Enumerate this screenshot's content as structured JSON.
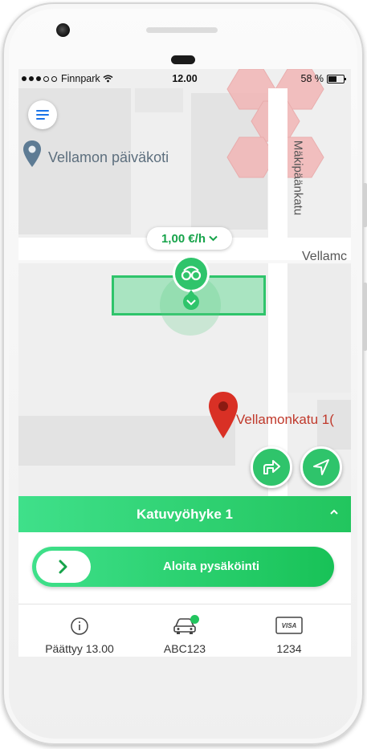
{
  "status_bar": {
    "carrier": "Finnpark",
    "time": "12.00",
    "battery": "58 %"
  },
  "map": {
    "poi_label": "Vellamon päiväkoti",
    "street_vertical": "Mäkipäänkatu",
    "street_horizontal": "Vellamc",
    "address_marker_label": "Vellamonkatu 1(",
    "price_label": "1,00 €/h",
    "zone_color": "#2fc46b",
    "marker_color": "#d93025"
  },
  "zone_bar": {
    "title": "Katuvyöhyke 1"
  },
  "start_parking": {
    "label": "Aloita pysäköinti"
  },
  "tabs": [
    {
      "icon": "info-icon",
      "label": "Päättyy 13.00"
    },
    {
      "icon": "car-icon",
      "label": "ABC123"
    },
    {
      "icon": "visa-card-icon",
      "label": "1234",
      "badge": "VISA"
    }
  ],
  "colors": {
    "accent_green": "#22c55e",
    "menu_blue": "#1a73e8"
  }
}
